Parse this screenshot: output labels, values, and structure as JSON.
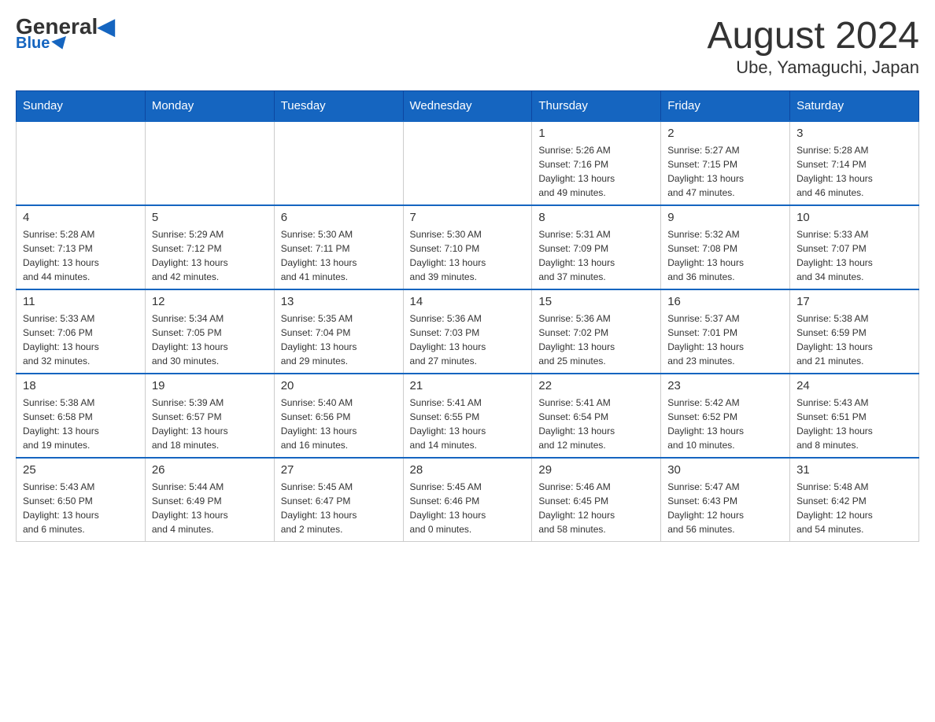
{
  "logo": {
    "general": "General",
    "blue": "Blue"
  },
  "title": "August 2024",
  "subtitle": "Ube, Yamaguchi, Japan",
  "days_of_week": [
    "Sunday",
    "Monday",
    "Tuesday",
    "Wednesday",
    "Thursday",
    "Friday",
    "Saturday"
  ],
  "weeks": [
    [
      {
        "num": "",
        "info": ""
      },
      {
        "num": "",
        "info": ""
      },
      {
        "num": "",
        "info": ""
      },
      {
        "num": "",
        "info": ""
      },
      {
        "num": "1",
        "info": "Sunrise: 5:26 AM\nSunset: 7:16 PM\nDaylight: 13 hours\nand 49 minutes."
      },
      {
        "num": "2",
        "info": "Sunrise: 5:27 AM\nSunset: 7:15 PM\nDaylight: 13 hours\nand 47 minutes."
      },
      {
        "num": "3",
        "info": "Sunrise: 5:28 AM\nSunset: 7:14 PM\nDaylight: 13 hours\nand 46 minutes."
      }
    ],
    [
      {
        "num": "4",
        "info": "Sunrise: 5:28 AM\nSunset: 7:13 PM\nDaylight: 13 hours\nand 44 minutes."
      },
      {
        "num": "5",
        "info": "Sunrise: 5:29 AM\nSunset: 7:12 PM\nDaylight: 13 hours\nand 42 minutes."
      },
      {
        "num": "6",
        "info": "Sunrise: 5:30 AM\nSunset: 7:11 PM\nDaylight: 13 hours\nand 41 minutes."
      },
      {
        "num": "7",
        "info": "Sunrise: 5:30 AM\nSunset: 7:10 PM\nDaylight: 13 hours\nand 39 minutes."
      },
      {
        "num": "8",
        "info": "Sunrise: 5:31 AM\nSunset: 7:09 PM\nDaylight: 13 hours\nand 37 minutes."
      },
      {
        "num": "9",
        "info": "Sunrise: 5:32 AM\nSunset: 7:08 PM\nDaylight: 13 hours\nand 36 minutes."
      },
      {
        "num": "10",
        "info": "Sunrise: 5:33 AM\nSunset: 7:07 PM\nDaylight: 13 hours\nand 34 minutes."
      }
    ],
    [
      {
        "num": "11",
        "info": "Sunrise: 5:33 AM\nSunset: 7:06 PM\nDaylight: 13 hours\nand 32 minutes."
      },
      {
        "num": "12",
        "info": "Sunrise: 5:34 AM\nSunset: 7:05 PM\nDaylight: 13 hours\nand 30 minutes."
      },
      {
        "num": "13",
        "info": "Sunrise: 5:35 AM\nSunset: 7:04 PM\nDaylight: 13 hours\nand 29 minutes."
      },
      {
        "num": "14",
        "info": "Sunrise: 5:36 AM\nSunset: 7:03 PM\nDaylight: 13 hours\nand 27 minutes."
      },
      {
        "num": "15",
        "info": "Sunrise: 5:36 AM\nSunset: 7:02 PM\nDaylight: 13 hours\nand 25 minutes."
      },
      {
        "num": "16",
        "info": "Sunrise: 5:37 AM\nSunset: 7:01 PM\nDaylight: 13 hours\nand 23 minutes."
      },
      {
        "num": "17",
        "info": "Sunrise: 5:38 AM\nSunset: 6:59 PM\nDaylight: 13 hours\nand 21 minutes."
      }
    ],
    [
      {
        "num": "18",
        "info": "Sunrise: 5:38 AM\nSunset: 6:58 PM\nDaylight: 13 hours\nand 19 minutes."
      },
      {
        "num": "19",
        "info": "Sunrise: 5:39 AM\nSunset: 6:57 PM\nDaylight: 13 hours\nand 18 minutes."
      },
      {
        "num": "20",
        "info": "Sunrise: 5:40 AM\nSunset: 6:56 PM\nDaylight: 13 hours\nand 16 minutes."
      },
      {
        "num": "21",
        "info": "Sunrise: 5:41 AM\nSunset: 6:55 PM\nDaylight: 13 hours\nand 14 minutes."
      },
      {
        "num": "22",
        "info": "Sunrise: 5:41 AM\nSunset: 6:54 PM\nDaylight: 13 hours\nand 12 minutes."
      },
      {
        "num": "23",
        "info": "Sunrise: 5:42 AM\nSunset: 6:52 PM\nDaylight: 13 hours\nand 10 minutes."
      },
      {
        "num": "24",
        "info": "Sunrise: 5:43 AM\nSunset: 6:51 PM\nDaylight: 13 hours\nand 8 minutes."
      }
    ],
    [
      {
        "num": "25",
        "info": "Sunrise: 5:43 AM\nSunset: 6:50 PM\nDaylight: 13 hours\nand 6 minutes."
      },
      {
        "num": "26",
        "info": "Sunrise: 5:44 AM\nSunset: 6:49 PM\nDaylight: 13 hours\nand 4 minutes."
      },
      {
        "num": "27",
        "info": "Sunrise: 5:45 AM\nSunset: 6:47 PM\nDaylight: 13 hours\nand 2 minutes."
      },
      {
        "num": "28",
        "info": "Sunrise: 5:45 AM\nSunset: 6:46 PM\nDaylight: 13 hours\nand 0 minutes."
      },
      {
        "num": "29",
        "info": "Sunrise: 5:46 AM\nSunset: 6:45 PM\nDaylight: 12 hours\nand 58 minutes."
      },
      {
        "num": "30",
        "info": "Sunrise: 5:47 AM\nSunset: 6:43 PM\nDaylight: 12 hours\nand 56 minutes."
      },
      {
        "num": "31",
        "info": "Sunrise: 5:48 AM\nSunset: 6:42 PM\nDaylight: 12 hours\nand 54 minutes."
      }
    ]
  ]
}
